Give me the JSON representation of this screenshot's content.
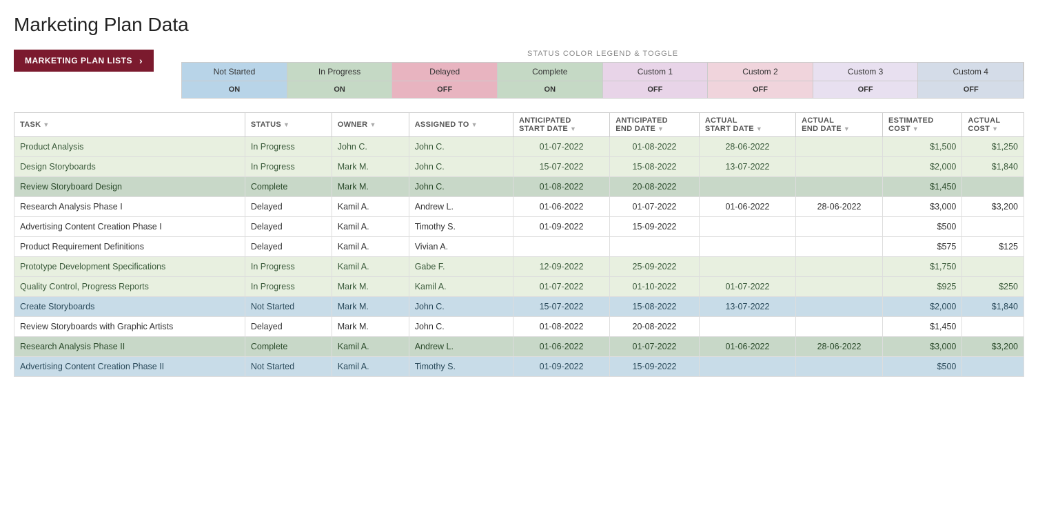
{
  "title": "Marketing Plan Data",
  "nav": {
    "label": "MARKETING PLAN LISTS",
    "chevron": "›"
  },
  "legend": {
    "title": "STATUS COLOR LEGEND & TOGGLE",
    "statuses": [
      {
        "name": "Not Started",
        "toggle": "ON",
        "bg": "bg-blue-light"
      },
      {
        "name": "In Progress",
        "toggle": "ON",
        "bg": "bg-green-light"
      },
      {
        "name": "Delayed",
        "toggle": "OFF",
        "bg": "bg-pink-light"
      },
      {
        "name": "Complete",
        "toggle": "ON",
        "bg": "bg-sage"
      },
      {
        "name": "Custom 1",
        "toggle": "OFF",
        "bg": "bg-purple-light"
      },
      {
        "name": "Custom 2",
        "toggle": "OFF",
        "bg": "bg-rose-light"
      },
      {
        "name": "Custom 3",
        "toggle": "OFF",
        "bg": "bg-lavender"
      },
      {
        "name": "Custom 4",
        "toggle": "OFF",
        "bg": "bg-steel"
      }
    ]
  },
  "table": {
    "columns": [
      {
        "id": "task",
        "label": "TASK",
        "filter": true
      },
      {
        "id": "status",
        "label": "STATUS",
        "filter": true
      },
      {
        "id": "owner",
        "label": "OWNER",
        "filter": true
      },
      {
        "id": "assigned_to",
        "label": "ASSIGNED TO",
        "filter": true
      },
      {
        "id": "ant_start",
        "label": "ANTICIPATED\nSTART DATE",
        "filter": true
      },
      {
        "id": "ant_end",
        "label": "ANTICIPATED\nEND DATE",
        "filter": true
      },
      {
        "id": "act_start",
        "label": "ACTUAL\nSTART DATE",
        "filter": true
      },
      {
        "id": "act_end",
        "label": "ACTUAL\nEND DATE",
        "filter": true
      },
      {
        "id": "est_cost",
        "label": "ESTIMATED\nCOST",
        "filter": true
      },
      {
        "id": "act_cost",
        "label": "ACTUAL\nCOST",
        "filter": true
      }
    ],
    "rows": [
      {
        "task": "Product Analysis",
        "status": "In Progress",
        "row_class": "row-in-progress",
        "status_class": "status-inprogress",
        "owner": "John C.",
        "assigned_to": "John C.",
        "ant_start": "01-07-2022",
        "ant_end": "01-08-2022",
        "act_start": "28-06-2022",
        "act_end": "",
        "est_cost": "$1,500",
        "act_cost": "$1,250"
      },
      {
        "task": "Design Storyboards",
        "status": "In Progress",
        "row_class": "row-in-progress",
        "status_class": "status-inprogress",
        "owner": "Mark M.",
        "assigned_to": "John C.",
        "ant_start": "15-07-2022",
        "ant_end": "15-08-2022",
        "act_start": "13-07-2022",
        "act_end": "",
        "est_cost": "$2,000",
        "act_cost": "$1,840"
      },
      {
        "task": "Review Storyboard Design",
        "status": "Complete",
        "row_class": "row-complete",
        "status_class": "status-complete",
        "owner": "Mark M.",
        "assigned_to": "John C.",
        "ant_start": "01-08-2022",
        "ant_end": "20-08-2022",
        "act_start": "",
        "act_end": "",
        "est_cost": "$1,450",
        "act_cost": ""
      },
      {
        "task": "Research Analysis Phase I",
        "status": "Delayed",
        "row_class": "row-delayed",
        "status_class": "status-delayed",
        "owner": "Kamil A.",
        "assigned_to": "Andrew L.",
        "ant_start": "01-06-2022",
        "ant_end": "01-07-2022",
        "act_start": "01-06-2022",
        "act_end": "28-06-2022",
        "est_cost": "$3,000",
        "act_cost": "$3,200"
      },
      {
        "task": "Advertising Content Creation Phase I",
        "status": "Delayed",
        "row_class": "row-delayed",
        "status_class": "status-delayed",
        "owner": "Kamil A.",
        "assigned_to": "Timothy S.",
        "ant_start": "01-09-2022",
        "ant_end": "15-09-2022",
        "act_start": "",
        "act_end": "",
        "est_cost": "$500",
        "act_cost": ""
      },
      {
        "task": "Product Requirement Definitions",
        "status": "Delayed",
        "row_class": "row-delayed",
        "status_class": "status-delayed",
        "owner": "Kamil A.",
        "assigned_to": "Vivian A.",
        "ant_start": "",
        "ant_end": "",
        "act_start": "",
        "act_end": "",
        "est_cost": "$575",
        "act_cost": "$125"
      },
      {
        "task": "Prototype Development Specifications",
        "status": "In Progress",
        "row_class": "row-in-progress",
        "status_class": "status-inprogress",
        "owner": "Kamil A.",
        "assigned_to": "Gabe F.",
        "ant_start": "12-09-2022",
        "ant_end": "25-09-2022",
        "act_start": "",
        "act_end": "",
        "est_cost": "$1,750",
        "act_cost": ""
      },
      {
        "task": "Quality Control, Progress Reports",
        "status": "In Progress",
        "row_class": "row-in-progress",
        "status_class": "status-inprogress",
        "owner": "Mark M.",
        "assigned_to": "Kamil A.",
        "ant_start": "01-07-2022",
        "ant_end": "01-10-2022",
        "act_start": "01-07-2022",
        "act_end": "",
        "est_cost": "$925",
        "act_cost": "$250"
      },
      {
        "task": "Create Storyboards",
        "status": "Not Started",
        "row_class": "row-not-started",
        "status_class": "status-notstarted",
        "owner": "Mark M.",
        "assigned_to": "John C.",
        "ant_start": "15-07-2022",
        "ant_end": "15-08-2022",
        "act_start": "13-07-2022",
        "act_end": "",
        "est_cost": "$2,000",
        "act_cost": "$1,840"
      },
      {
        "task": "Review Storyboards with Graphic Artists",
        "status": "Delayed",
        "row_class": "row-delayed",
        "status_class": "status-delayed",
        "owner": "Mark M.",
        "assigned_to": "John C.",
        "ant_start": "01-08-2022",
        "ant_end": "20-08-2022",
        "act_start": "",
        "act_end": "",
        "est_cost": "$1,450",
        "act_cost": ""
      },
      {
        "task": "Research Analysis Phase II",
        "status": "Complete",
        "row_class": "row-complete",
        "status_class": "status-complete",
        "owner": "Kamil A.",
        "assigned_to": "Andrew L.",
        "ant_start": "01-06-2022",
        "ant_end": "01-07-2022",
        "act_start": "01-06-2022",
        "act_end": "28-06-2022",
        "est_cost": "$3,000",
        "act_cost": "$3,200"
      },
      {
        "task": "Advertising Content Creation Phase II",
        "status": "Not Started",
        "row_class": "row-not-started",
        "status_class": "status-notstarted",
        "owner": "Kamil A.",
        "assigned_to": "Timothy S.",
        "ant_start": "01-09-2022",
        "ant_end": "15-09-2022",
        "act_start": "",
        "act_end": "",
        "est_cost": "$500",
        "act_cost": ""
      }
    ]
  }
}
